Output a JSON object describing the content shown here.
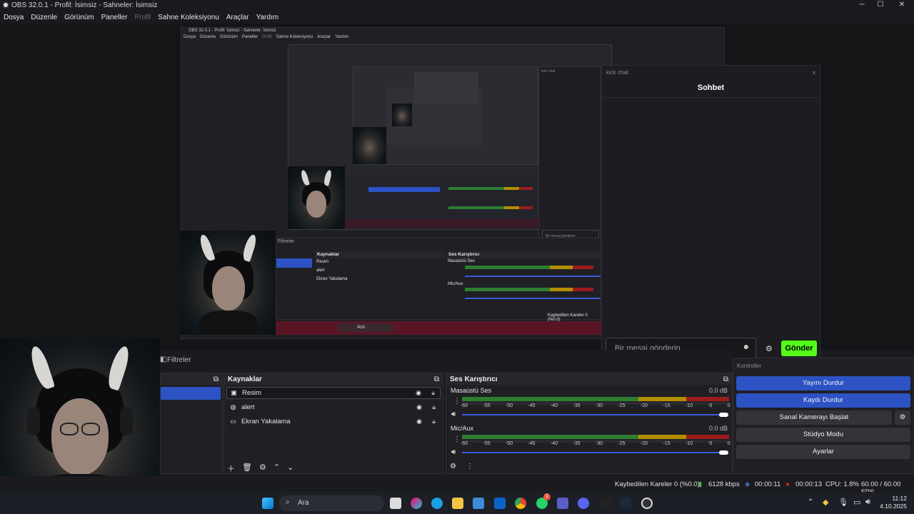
{
  "window": {
    "title": "OBS 32.0.1 - Profil: İsimsiz - Sahneler: İsimsiz"
  },
  "menu": [
    "Dosya",
    "Düzenle",
    "Görünüm",
    "Paneller",
    "Profil",
    "Sahne Koleksiyonu",
    "Araçlar",
    "Yardım"
  ],
  "nested": {
    "title": "OBS 32.0.1 - Profil: İsimsiz - Sahneler: İsimsiz",
    "menu": [
      "Dosya",
      "Düzenle",
      "Görünüm",
      "Paneller",
      "Profil",
      "Sahne Koleksiyonu",
      "Araçlar",
      "Yardım"
    ],
    "filters_label": "Filtreler",
    "sources_title": "Kaynaklar",
    "mixer_title": "Ses Karıştırıcı",
    "sources": [
      "Resim",
      "alert",
      "Ekran Yakalama"
    ],
    "desktop_audio": "Masaüstü Ses",
    "mic": "Mic/Aux",
    "dropped": "Kaybedilen Kareler 0 (%0.0)",
    "search": "Ara",
    "chat_label": "kick chat",
    "chat_placeholder": "Bir mesaj gönderin"
  },
  "chat": {
    "window_label": "kick chat",
    "title": "Sohbet",
    "input_placeholder": "Bir mesaj gönderin",
    "send_label": "Gönder",
    "close_label": "x"
  },
  "filters": {
    "label": "Filtreler"
  },
  "sources": {
    "title": "Kaynaklar",
    "items": [
      {
        "label": "Resim",
        "icon": "image-icon"
      },
      {
        "label": "alert",
        "icon": "browser-icon"
      },
      {
        "label": "Ekran Yakalama",
        "icon": "monitor-icon"
      }
    ]
  },
  "mixer": {
    "title": "Ses Karıştırıcı",
    "channels": [
      {
        "name": "Masaüstü Ses",
        "db": "0.0 dB",
        "volume": 1.0
      },
      {
        "name": "Mic/Aux",
        "db": "0.0 dB",
        "volume": 1.0
      }
    ],
    "scale": [
      "-60",
      "-55",
      "-50",
      "-45",
      "-40",
      "-35",
      "-30",
      "-25",
      "-20",
      "-15",
      "-10",
      "-5",
      "0"
    ]
  },
  "controls": {
    "title": "Kontroller",
    "stop_stream": "Yayını Durdur",
    "stop_record": "Kaydı Durdur",
    "virtual_cam": "Sanal Kamerayı Başlat",
    "studio": "Stüdyo Modu",
    "settings": "Ayarlar"
  },
  "status": {
    "dropped": "Kaybedilen Kareler 0 (%0.0)",
    "bitrate": "6128 kbps",
    "stream_time": "00:00:11",
    "record_time": "00:00:13",
    "cpu": "CPU: 1.8%",
    "fps": "60.00 / 60.00 FPS"
  },
  "taskbar": {
    "search": "Ara",
    "time": "11:12",
    "date": "4.10.2025",
    "whatsapp_badge": "1"
  },
  "colors": {
    "accent": "#2d52c4",
    "kick_green": "#53fc18",
    "record_red": "#e02020"
  }
}
